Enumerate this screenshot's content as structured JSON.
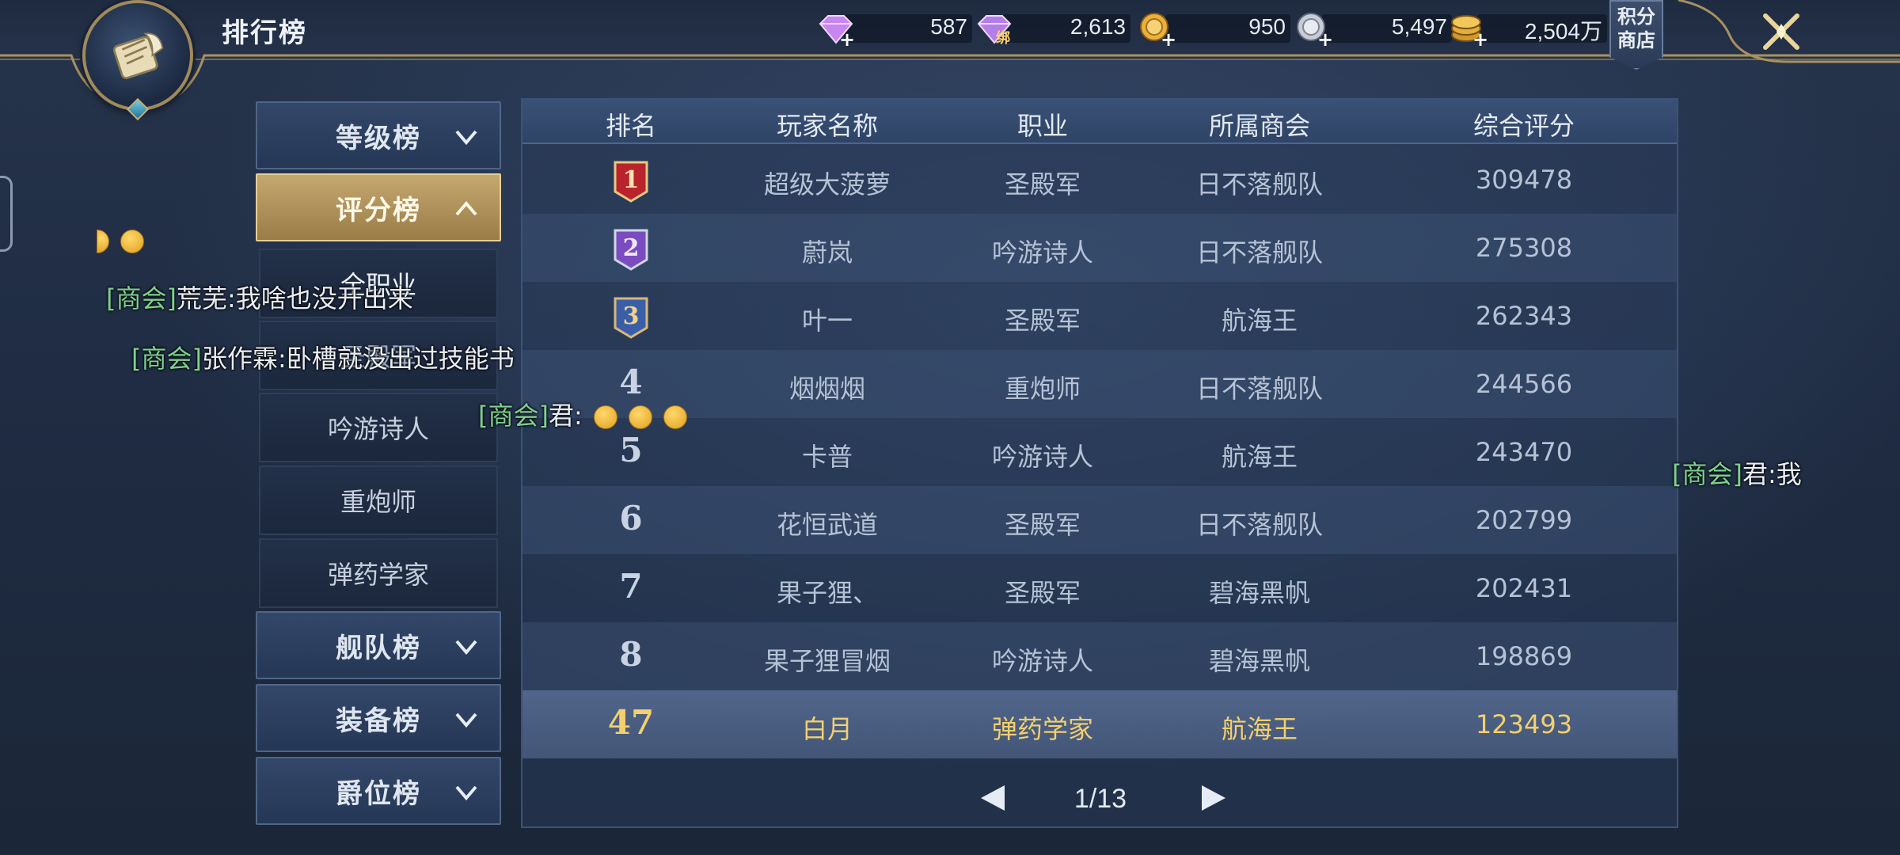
{
  "header": {
    "title": "排行榜",
    "currencies": [
      {
        "name": "diamond",
        "icon": "diamond-plus-icon",
        "value": "587"
      },
      {
        "name": "bound-diamond",
        "icon": "bound-diamond-icon",
        "value": "2,613",
        "badge": "绑"
      },
      {
        "name": "gold-coin",
        "icon": "gold-coin-plus-icon",
        "value": "950"
      },
      {
        "name": "silver-coin",
        "icon": "silver-coin-plus-icon",
        "value": "5,497"
      },
      {
        "name": "coin-stack",
        "icon": "coin-stack-plus-icon",
        "value": "2,504万"
      }
    ],
    "shop_label_line1": "积分",
    "shop_label_line2": "商店"
  },
  "nav": {
    "level_board": "等级榜",
    "score_board": "评分榜",
    "sub_items": [
      "全职业",
      "圣殿军",
      "吟游诗人",
      "重炮师",
      "弹药学家"
    ],
    "fleet_board": "舰队榜",
    "equipment_board": "装备榜",
    "peerage_board": "爵位榜"
  },
  "table": {
    "headers": {
      "rank": "排名",
      "player": "玩家名称",
      "class": "职业",
      "guild": "所属商会",
      "score": "综合评分"
    },
    "rows": [
      {
        "rank": "1",
        "player": "超级大菠萝",
        "class": "圣殿军",
        "guild": "日不落舰队",
        "score": "309478"
      },
      {
        "rank": "2",
        "player": "蔚岚",
        "class": "吟游诗人",
        "guild": "日不落舰队",
        "score": "275308"
      },
      {
        "rank": "3",
        "player": "叶一",
        "class": "圣殿军",
        "guild": "航海王",
        "score": "262343"
      },
      {
        "rank": "4",
        "player": "烟烟烟",
        "class": "重炮师",
        "guild": "日不落舰队",
        "score": "244566"
      },
      {
        "rank": "5",
        "player": "卡普",
        "class": "吟游诗人",
        "guild": "航海王",
        "score": "243470"
      },
      {
        "rank": "6",
        "player": "花恒武道",
        "class": "圣殿军",
        "guild": "日不落舰队",
        "score": "202799"
      },
      {
        "rank": "7",
        "player": "果子狸、",
        "class": "圣殿军",
        "guild": "碧海黑帆",
        "score": "202431"
      },
      {
        "rank": "8",
        "player": "果子狸冒烟",
        "class": "吟游诗人",
        "guild": "碧海黑帆",
        "score": "198869"
      }
    ],
    "self_row": {
      "rank": "47",
      "player": "白月",
      "class": "弹药学家",
      "guild": "航海王",
      "score": "123493"
    },
    "pager": "1/13"
  },
  "chat": [
    {
      "tag": "[商会]",
      "text": "荒芜:我啥也没开出来"
    },
    {
      "tag": "[商会]",
      "text": "张作霖:卧槽就没出过技能书"
    },
    {
      "tag": "[商会]",
      "text": "君:"
    },
    {
      "tag": "[商会]",
      "text": "君:我"
    }
  ],
  "colors": {
    "accent_gold": "#c5a76f",
    "self_highlight": "#f3cf6e",
    "chat_tag": "#7fd08f"
  }
}
